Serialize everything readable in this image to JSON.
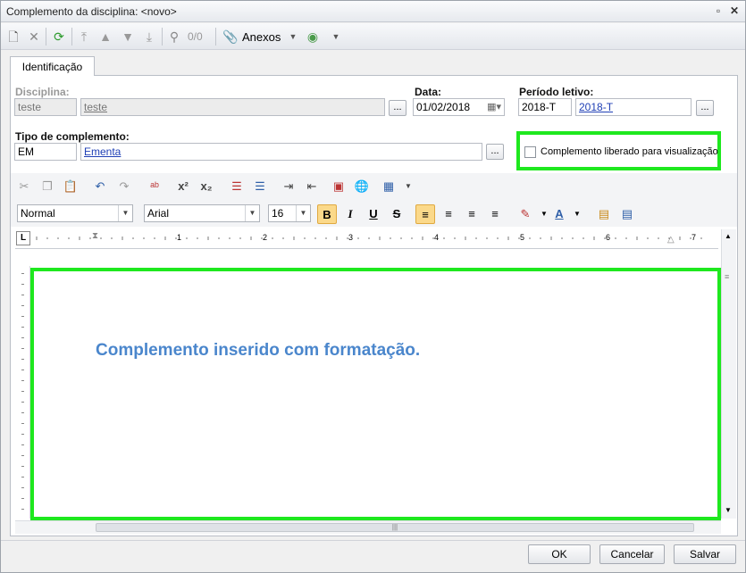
{
  "window": {
    "title": "Complemento da disciplina: <novo>"
  },
  "toolbar": {
    "counter": "0/0",
    "anexos_label": "Anexos"
  },
  "tabs": [
    {
      "label": "Identificação"
    }
  ],
  "form": {
    "disciplina": {
      "label": "Disciplina:",
      "code": "teste",
      "name": "teste"
    },
    "data": {
      "label": "Data:",
      "value": "01/02/2018"
    },
    "periodo": {
      "label": "Período letivo:",
      "code": "2018-T",
      "name": "2018-T"
    },
    "tipo": {
      "label": "Tipo de complemento:",
      "code": "EM",
      "name": "Ementa"
    },
    "liberado": {
      "label": "Complemento liberado para visualização",
      "checked": false
    },
    "lookup_button": "..."
  },
  "editor_toolbar": {
    "style": "Normal",
    "font": "Arial",
    "size": "16",
    "bold": "B",
    "italic": "I",
    "underline": "U",
    "strike": "S"
  },
  "ruler": {
    "numbers": [
      "1",
      "2",
      "3",
      "4",
      "5",
      "6",
      "7"
    ],
    "corner": "L"
  },
  "editor": {
    "content": "Complemento inserido com formatação.",
    "text_color": "#4a86cc"
  },
  "footer": {
    "ok": "OK",
    "cancel": "Cancelar",
    "save": "Salvar"
  },
  "colors": {
    "highlight": "#1ee81e",
    "link": "#1f3fb5"
  }
}
